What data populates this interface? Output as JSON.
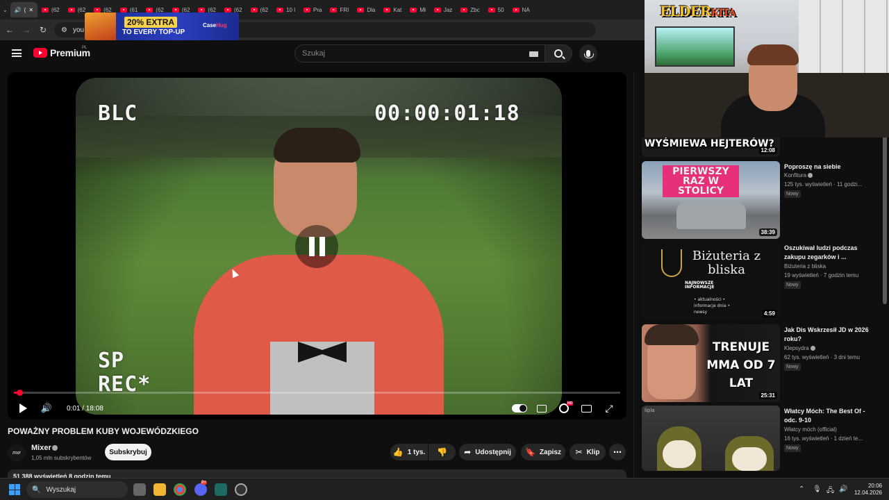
{
  "browser": {
    "tabs": [
      "(",
      "(62",
      "(62",
      "(62",
      "(61",
      "(62",
      "(62",
      "(62",
      "(62",
      "(62",
      "10 l",
      "Pra",
      "FRI",
      "Dla",
      "Kat",
      "Mł",
      "Jaz",
      "Zbc",
      "50",
      "NA"
    ],
    "address_text": "you"
  },
  "ad": {
    "offer_line1": "20% EXTRA",
    "offer_line2": "TO EVERY TOP-UP",
    "brand_a": "Case",
    "brand_b": "Hug"
  },
  "youtube": {
    "logo_text": "Premium",
    "region": "PL",
    "search_placeholder": "Szukaj"
  },
  "player": {
    "osd_channel": "BLC",
    "osd_timecode": "00:00:01:18",
    "osd_mode": "SP",
    "osd_rec": "REC*",
    "time_display": "0:01 / 18:08",
    "progress_fraction": 0.001,
    "hd_badge": "HD"
  },
  "video": {
    "title": "POWAŻNY PROBLEM KUBY WOJEWÓDZKIEGO",
    "channel": "Mixer",
    "channel_avatar_text": "mxr",
    "subscribers": "1,05 mln subskrybentów",
    "subscribe_label": "Subskrybuj",
    "likes": "1 tys.",
    "share_label": "Udostępnij",
    "save_label": "Zapisz",
    "clip_label": "Klip",
    "views_line": "51 388 wyświetleń  8 godzin temu"
  },
  "recommendations": [
    {
      "thumb_text": "WYŚMIEWA HEJTERÓW?",
      "duration": "12:08"
    },
    {
      "thumb_text": "PIERWSZY RAZ W STOLICY",
      "title": "Poproszę na siebie",
      "channel": "Konfitura",
      "meta": "125 tys. wyświetleń · 11 godzi...",
      "badge": "Nowy",
      "duration": "38:39"
    },
    {
      "thumb_text": "Biżuteria z bliska",
      "thumb_sub": "NAJNOWSZE INFORMACJE",
      "thumb_list": "• aktualności • informacje dnia • newsy",
      "title": "Oszukiwał ludzi podczas zakupu zegarków i ...",
      "channel": "Biżuteria z bliska",
      "meta": "19 wyświetleń · 7 godzin temu",
      "badge": "Nowy",
      "duration": "4:59"
    },
    {
      "thumb_text": "TRENUJE MMA OD 7 LAT",
      "title": "Jak Dis Wskrzesił JD w 2026 roku?",
      "channel": "Klepsydra",
      "meta": "62 tys. wyświetleń · 3 dni temu",
      "badge": "Nowy",
      "duration": "25:31"
    },
    {
      "thumb_text": "",
      "thumb_corner": "lipla",
      "title": "Włatcy Móch: The Best Of - odc. 9-10",
      "channel": "Włatcy móch (official)",
      "meta": "16 tys. wyświetleń · 1 dzień te...",
      "badge": "Nowy"
    }
  ],
  "webcam": {
    "logo_a": "ELDER",
    "logo_b": "KITA"
  },
  "taskbar": {
    "search_placeholder": "Wyszukaj",
    "discord_badge": "9+",
    "time": "20:06",
    "date": "12.04.2026"
  }
}
